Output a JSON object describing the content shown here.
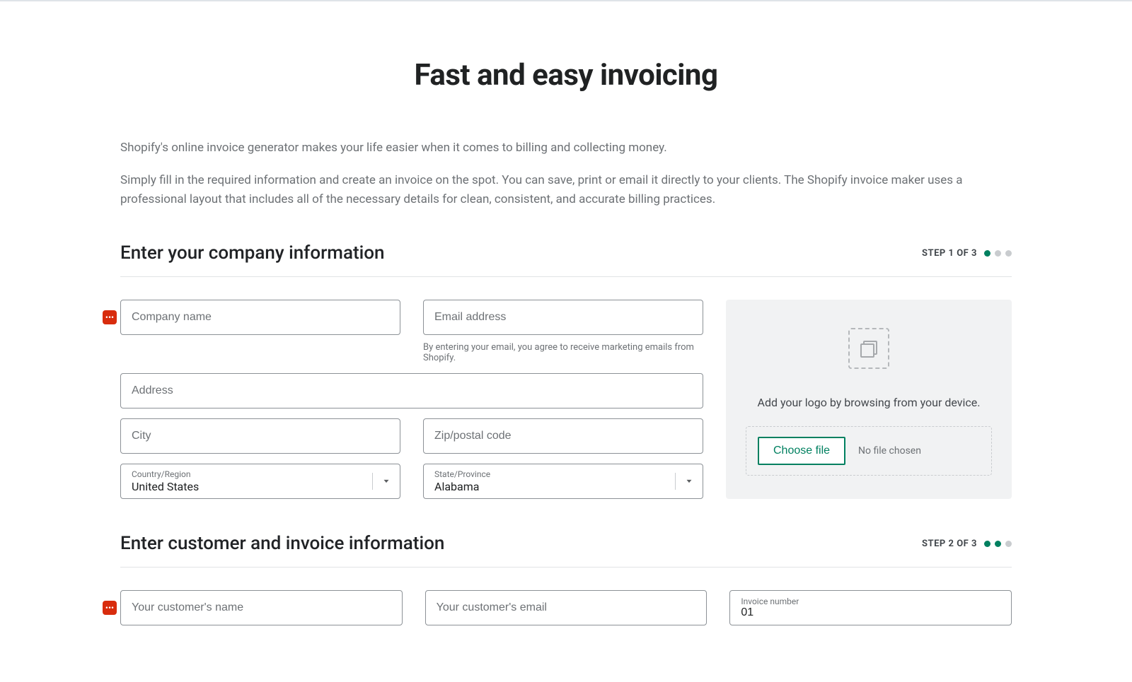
{
  "page": {
    "title": "Fast and easy invoicing",
    "intro1": "Shopify's online invoice generator makes your life easier when it comes to billing and collecting money.",
    "intro2": "Simply fill in the required information and create an invoice on the spot. You can save, print or email it directly to your clients. The Shopify invoice maker uses a professional layout that includes all of the necessary details for clean, consistent, and accurate billing practices."
  },
  "section1": {
    "heading": "Enter your company information",
    "step": "STEP 1 OF 3",
    "company_ph": "Company name",
    "email_ph": "Email address",
    "email_helper": "By entering your email, you agree to receive marketing emails from Shopify.",
    "address_ph": "Address",
    "city_ph": "City",
    "zip_ph": "Zip/postal code",
    "country_label": "Country/Region",
    "country_value": "United States",
    "state_label": "State/Province",
    "state_value": "Alabama"
  },
  "upload": {
    "text": "Add your logo by browsing from your device.",
    "choose": "Choose file",
    "none": "No file chosen"
  },
  "section2": {
    "heading": "Enter customer and invoice information",
    "step": "STEP 2 OF 3",
    "customer_name_ph": "Your customer's name",
    "customer_email_ph": "Your customer's email",
    "invoice_label": "Invoice number",
    "invoice_value": "01"
  }
}
